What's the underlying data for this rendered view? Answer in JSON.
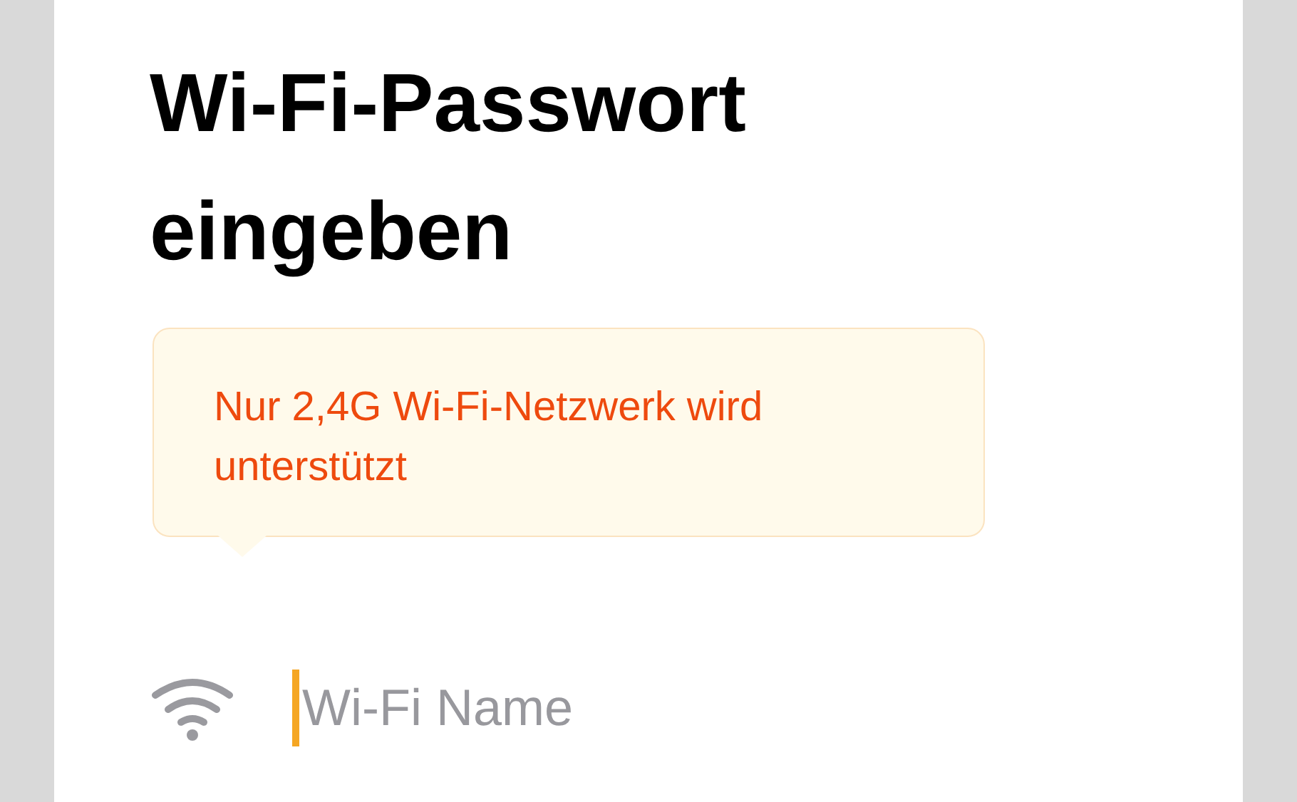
{
  "title": "Wi-Fi-Passwort eingeben",
  "notice": {
    "text": "Nur 2,4G Wi-Fi-Netzwerk wird unterstützt"
  },
  "wifi_field": {
    "placeholder": "Wi-Fi Name",
    "focused": true
  }
}
